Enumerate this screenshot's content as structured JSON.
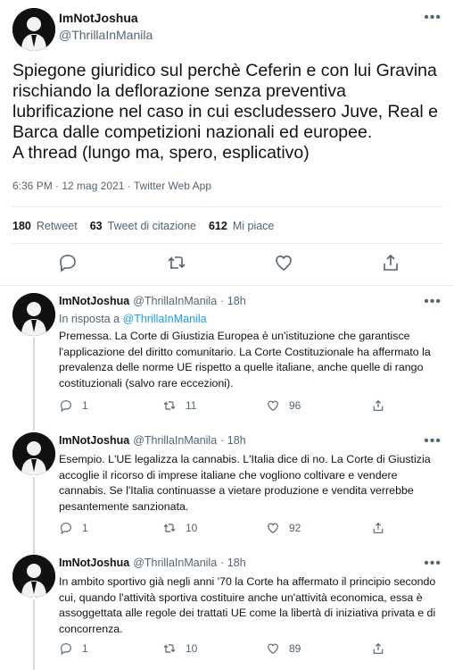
{
  "main_tweet": {
    "author_name": "ImNotJoshua",
    "author_handle": "@ThrillaInManila",
    "text": "Spiegone giuridico sul perchè Ceferin e con lui Gravina rischiando la deflorazione senza preventiva lubrificazione nel caso in cui escludessero Juve, Real e Barca dalle competizioni nazionali ed europee.\nA thread (lungo ma, spero, esplicativo)",
    "meta": "6:36 PM · 12 mag 2021 · Twitter Web App",
    "stats": {
      "retweets_count": "180",
      "retweets_label": "Retweet",
      "quotes_count": "63",
      "quotes_label": "Tweet di citazione",
      "likes_count": "612",
      "likes_label": "Mi piace"
    },
    "icons": [
      "reply-icon",
      "retweet-icon",
      "like-icon",
      "share-icon"
    ]
  },
  "replies": [
    {
      "author_name": "ImNotJoshua",
      "author_handle": "@ThrillaInManila",
      "time": "· 18h",
      "reply_prefix": "In risposta a",
      "reply_to": "@ThrillaInManila",
      "text": "Premessa. La Corte di Giustizia Europea è un'istituzione che garantisce l'applicazione del diritto comunitario. La Corte Costituzionale ha affermato la prevalenza delle norme UE rispetto a quelle italiane, anche quelle di rango costituzionali (salvo rare eccezioni).",
      "replies": "1",
      "retweets": "11",
      "likes": "96"
    },
    {
      "author_name": "ImNotJoshua",
      "author_handle": "@ThrillaInManila",
      "time": "· 18h",
      "text": "Esempio. L'UE legalizza la cannabis. L'Italia dice di no. La Corte di Giustizia accoglie il ricorso di imprese italiane che vogliono coltivare e vendere cannabis. Se l'Italia continuasse a vietare produzione e vendita verrebbe pesantemente sanzionata.",
      "replies": "1",
      "retweets": "10",
      "likes": "92"
    },
    {
      "author_name": "ImNotJoshua",
      "author_handle": "@ThrillaInManila",
      "time": "· 18h",
      "text": "In ambito sportivo già negli anni '70 la Corte ha affermato il principio secondo cui, quando l'attività sportiva costituire anche un'attività economica, essa è assoggettata alle regole dei trattati UE come la libertà di iniziativa privata e di concorrenza.",
      "replies": "1",
      "retweets": "10",
      "likes": "89"
    }
  ],
  "more_icon": "•••"
}
